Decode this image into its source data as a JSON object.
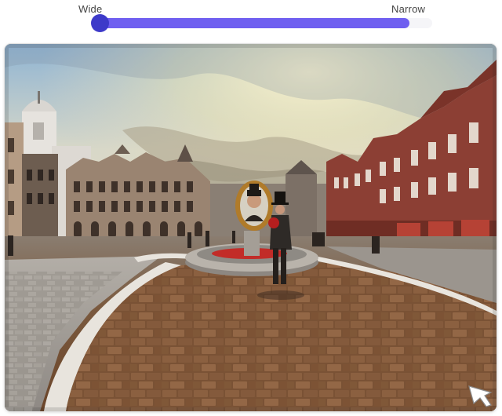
{
  "slider": {
    "left_label": "Wide",
    "right_label": "Narrow",
    "value_fraction": 0.0
  },
  "scene": {
    "cursor_icon": "cursor-arrow-icon"
  },
  "colors": {
    "slider_fill": "#6f5ff0",
    "slider_thumb": "#3d3ac9"
  }
}
